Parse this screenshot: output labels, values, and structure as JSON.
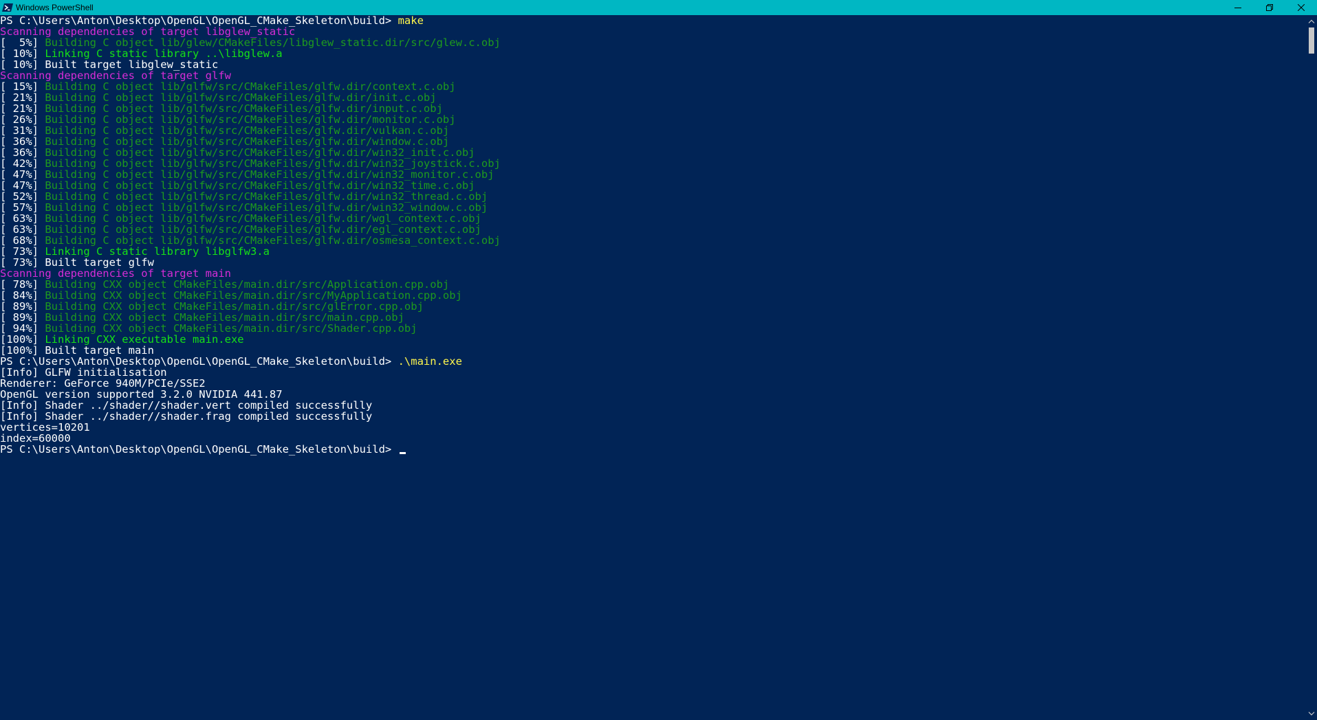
{
  "window": {
    "title": "Windows PowerShell",
    "title_bar_color": "#00b7c3",
    "background_color": "#012456",
    "icons": {
      "app": "powershell-icon",
      "minimize": "minimize-icon",
      "restore": "restore-icon",
      "close": "close-icon"
    }
  },
  "colors": {
    "white": "#ffffff",
    "magenta": "#d62dd6",
    "dark_green": "#1e9a1e",
    "light_green": "#16e016",
    "yellow": "#fff74d"
  },
  "terminal": {
    "lines": [
      {
        "parts": [
          {
            "t": "PS C:\\Users\\Anton\\Desktop\\OpenGL\\OpenGL_CMake_Skeleton\\build> ",
            "c": "white"
          },
          {
            "t": "make",
            "c": "yellow"
          }
        ]
      },
      {
        "parts": [
          {
            "t": "Scanning dependencies of target libglew_static",
            "c": "magenta"
          }
        ]
      },
      {
        "parts": [
          {
            "t": "[  5%] ",
            "c": "white"
          },
          {
            "t": "Building C object lib/glew/CMakeFiles/libglew_static.dir/src/glew.c.obj",
            "c": "dark_green"
          }
        ]
      },
      {
        "parts": [
          {
            "t": "[ 10%] ",
            "c": "white"
          },
          {
            "t": "Linking C static library ..\\libglew.a",
            "c": "light_green"
          }
        ]
      },
      {
        "parts": [
          {
            "t": "[ 10%] Built target libglew_static",
            "c": "white"
          }
        ]
      },
      {
        "parts": [
          {
            "t": "Scanning dependencies of target glfw",
            "c": "magenta"
          }
        ]
      },
      {
        "parts": [
          {
            "t": "[ 15%] ",
            "c": "white"
          },
          {
            "t": "Building C object lib/glfw/src/CMakeFiles/glfw.dir/context.c.obj",
            "c": "dark_green"
          }
        ]
      },
      {
        "parts": [
          {
            "t": "[ 21%] ",
            "c": "white"
          },
          {
            "t": "Building C object lib/glfw/src/CMakeFiles/glfw.dir/init.c.obj",
            "c": "dark_green"
          }
        ]
      },
      {
        "parts": [
          {
            "t": "[ 21%] ",
            "c": "white"
          },
          {
            "t": "Building C object lib/glfw/src/CMakeFiles/glfw.dir/input.c.obj",
            "c": "dark_green"
          }
        ]
      },
      {
        "parts": [
          {
            "t": "[ 26%] ",
            "c": "white"
          },
          {
            "t": "Building C object lib/glfw/src/CMakeFiles/glfw.dir/monitor.c.obj",
            "c": "dark_green"
          }
        ]
      },
      {
        "parts": [
          {
            "t": "[ 31%] ",
            "c": "white"
          },
          {
            "t": "Building C object lib/glfw/src/CMakeFiles/glfw.dir/vulkan.c.obj",
            "c": "dark_green"
          }
        ]
      },
      {
        "parts": [
          {
            "t": "[ 36%] ",
            "c": "white"
          },
          {
            "t": "Building C object lib/glfw/src/CMakeFiles/glfw.dir/window.c.obj",
            "c": "dark_green"
          }
        ]
      },
      {
        "parts": [
          {
            "t": "[ 36%] ",
            "c": "white"
          },
          {
            "t": "Building C object lib/glfw/src/CMakeFiles/glfw.dir/win32_init.c.obj",
            "c": "dark_green"
          }
        ]
      },
      {
        "parts": [
          {
            "t": "[ 42%] ",
            "c": "white"
          },
          {
            "t": "Building C object lib/glfw/src/CMakeFiles/glfw.dir/win32_joystick.c.obj",
            "c": "dark_green"
          }
        ]
      },
      {
        "parts": [
          {
            "t": "[ 47%] ",
            "c": "white"
          },
          {
            "t": "Building C object lib/glfw/src/CMakeFiles/glfw.dir/win32_monitor.c.obj",
            "c": "dark_green"
          }
        ]
      },
      {
        "parts": [
          {
            "t": "[ 47%] ",
            "c": "white"
          },
          {
            "t": "Building C object lib/glfw/src/CMakeFiles/glfw.dir/win32_time.c.obj",
            "c": "dark_green"
          }
        ]
      },
      {
        "parts": [
          {
            "t": "[ 52%] ",
            "c": "white"
          },
          {
            "t": "Building C object lib/glfw/src/CMakeFiles/glfw.dir/win32_thread.c.obj",
            "c": "dark_green"
          }
        ]
      },
      {
        "parts": [
          {
            "t": "[ 57%] ",
            "c": "white"
          },
          {
            "t": "Building C object lib/glfw/src/CMakeFiles/glfw.dir/win32_window.c.obj",
            "c": "dark_green"
          }
        ]
      },
      {
        "parts": [
          {
            "t": "[ 63%] ",
            "c": "white"
          },
          {
            "t": "Building C object lib/glfw/src/CMakeFiles/glfw.dir/wgl_context.c.obj",
            "c": "dark_green"
          }
        ]
      },
      {
        "parts": [
          {
            "t": "[ 63%] ",
            "c": "white"
          },
          {
            "t": "Building C object lib/glfw/src/CMakeFiles/glfw.dir/egl_context.c.obj",
            "c": "dark_green"
          }
        ]
      },
      {
        "parts": [
          {
            "t": "[ 68%] ",
            "c": "white"
          },
          {
            "t": "Building C object lib/glfw/src/CMakeFiles/glfw.dir/osmesa_context.c.obj",
            "c": "dark_green"
          }
        ]
      },
      {
        "parts": [
          {
            "t": "[ 73%] ",
            "c": "white"
          },
          {
            "t": "Linking C static library libglfw3.a",
            "c": "light_green"
          }
        ]
      },
      {
        "parts": [
          {
            "t": "[ 73%] Built target glfw",
            "c": "white"
          }
        ]
      },
      {
        "parts": [
          {
            "t": "Scanning dependencies of target main",
            "c": "magenta"
          }
        ]
      },
      {
        "parts": [
          {
            "t": "[ 78%] ",
            "c": "white"
          },
          {
            "t": "Building CXX object CMakeFiles/main.dir/src/Application.cpp.obj",
            "c": "dark_green"
          }
        ]
      },
      {
        "parts": [
          {
            "t": "[ 84%] ",
            "c": "white"
          },
          {
            "t": "Building CXX object CMakeFiles/main.dir/src/MyApplication.cpp.obj",
            "c": "dark_green"
          }
        ]
      },
      {
        "parts": [
          {
            "t": "[ 89%] ",
            "c": "white"
          },
          {
            "t": "Building CXX object CMakeFiles/main.dir/src/glError.cpp.obj",
            "c": "dark_green"
          }
        ]
      },
      {
        "parts": [
          {
            "t": "[ 89%] ",
            "c": "white"
          },
          {
            "t": "Building CXX object CMakeFiles/main.dir/src/main.cpp.obj",
            "c": "dark_green"
          }
        ]
      },
      {
        "parts": [
          {
            "t": "[ 94%] ",
            "c": "white"
          },
          {
            "t": "Building CXX object CMakeFiles/main.dir/src/Shader.cpp.obj",
            "c": "dark_green"
          }
        ]
      },
      {
        "parts": [
          {
            "t": "[100%] ",
            "c": "white"
          },
          {
            "t": "Linking CXX executable main.exe",
            "c": "light_green"
          }
        ]
      },
      {
        "parts": [
          {
            "t": "[100%] Built target main",
            "c": "white"
          }
        ]
      },
      {
        "parts": [
          {
            "t": "PS C:\\Users\\Anton\\Desktop\\OpenGL\\OpenGL_CMake_Skeleton\\build> ",
            "c": "white"
          },
          {
            "t": ".\\main.exe",
            "c": "yellow"
          }
        ]
      },
      {
        "parts": [
          {
            "t": "[Info] GLFW initialisation",
            "c": "white"
          }
        ]
      },
      {
        "parts": [
          {
            "t": "Renderer: GeForce 940M/PCIe/SSE2",
            "c": "white"
          }
        ]
      },
      {
        "parts": [
          {
            "t": "OpenGL version supported 3.2.0 NVIDIA 441.87",
            "c": "white"
          }
        ]
      },
      {
        "parts": [
          {
            "t": "[Info] Shader ../shader//shader.vert compiled successfully",
            "c": "white"
          }
        ]
      },
      {
        "parts": [
          {
            "t": "[Info] Shader ../shader//shader.frag compiled successfully",
            "c": "white"
          }
        ]
      },
      {
        "parts": [
          {
            "t": "vertices=10201",
            "c": "white"
          }
        ]
      },
      {
        "parts": [
          {
            "t": "index=60000",
            "c": "white"
          }
        ]
      },
      {
        "parts": [
          {
            "t": "PS C:\\Users\\Anton\\Desktop\\OpenGL\\OpenGL_CMake_Skeleton\\build> ",
            "c": "white"
          }
        ],
        "cursor": true
      }
    ]
  }
}
